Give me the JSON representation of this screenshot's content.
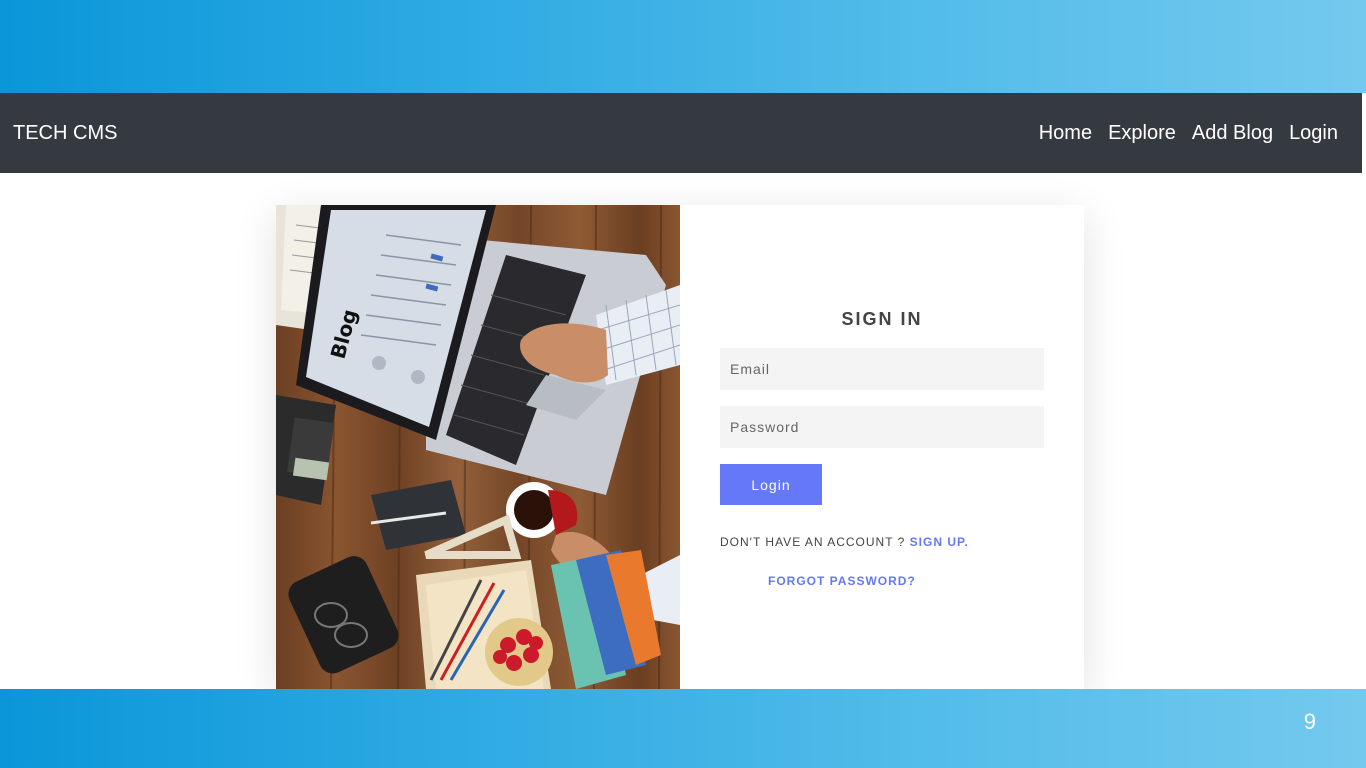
{
  "navbar": {
    "brand": "TECH CMS",
    "links": [
      "Home",
      "Explore",
      "Add Blog",
      "Login"
    ]
  },
  "hero": {
    "image_text": "Blog"
  },
  "form": {
    "title": "SIGN IN",
    "email_placeholder": "Email",
    "password_placeholder": "Password",
    "login_label": "Login",
    "signup_prompt": "DON'T HAVE AN ACCOUNT ?",
    "signup_link": "SIGN UP.",
    "forgot_link": "FORGOT PASSWORD?"
  },
  "slide": {
    "number": "9"
  },
  "colors": {
    "navbar": "#343a40",
    "accent": "#6578f7",
    "band_start": "#0a96d9",
    "band_end": "#74c9ee"
  }
}
